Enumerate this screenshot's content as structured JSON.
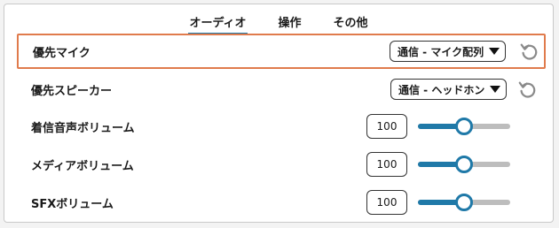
{
  "tabs": [
    {
      "label": "オーディオ",
      "active": true
    },
    {
      "label": "操作",
      "active": false
    },
    {
      "label": "その他",
      "active": false
    }
  ],
  "settings": [
    {
      "label": "優先マイク",
      "type": "select",
      "value": "通信 - マイク配列",
      "highlighted": true
    },
    {
      "label": "優先スピーカー",
      "type": "select",
      "value": "通信 - ヘッドホン",
      "highlighted": false
    },
    {
      "label": "着信音声ボリューム",
      "type": "slider",
      "value": "100",
      "level": 0.5
    },
    {
      "label": "メディアボリューム",
      "type": "slider",
      "value": "100",
      "level": 0.5
    },
    {
      "label": "SFXボリューム",
      "type": "slider",
      "value": "100",
      "level": 0.5
    }
  ],
  "icons": {
    "reset": "reset-icon",
    "dropdown": "chevron-down-icon"
  },
  "colors": {
    "accent": "#1f79a8",
    "highlight": "#e07b4c",
    "track": "#bdbdbd"
  }
}
